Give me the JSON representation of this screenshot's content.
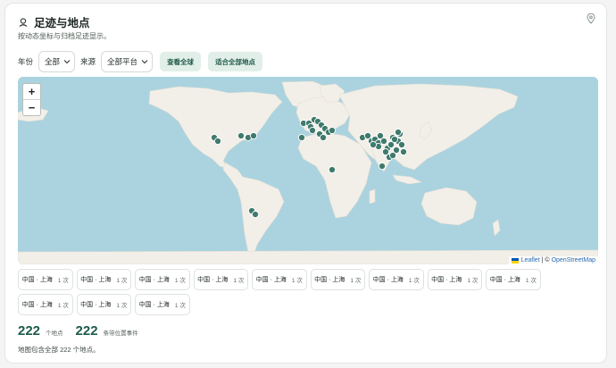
{
  "header": {
    "title": "足迹与地点",
    "subtitle": "按动态坐标与归档足迹显示。"
  },
  "filters": {
    "year_label": "年份",
    "year_value": "全部",
    "source_label": "来源",
    "source_value": "全部平台",
    "view_world_button": "查看全球",
    "fit_all_button": "适合全部地点"
  },
  "map": {
    "zoom_in": "+",
    "zoom_out": "−",
    "attribution_leaflet": "Leaflet",
    "attribution_sep": "| ©",
    "attribution_osm": "OpenStreetMap",
    "water_color": "#aad3df",
    "land_color": "#f2efe9",
    "marker_color": "#3f7a6c"
  },
  "places": [
    {
      "name": "中国 · 上海",
      "count": "1 次"
    },
    {
      "name": "中国 · 上海",
      "count": "1 次"
    },
    {
      "name": "中国 · 上海",
      "count": "1 次"
    },
    {
      "name": "中国 · 上海",
      "count": "1 次"
    },
    {
      "name": "中国 · 上海",
      "count": "1 次"
    },
    {
      "name": "中国 · 上海",
      "count": "1 次"
    },
    {
      "name": "中国 · 上海",
      "count": "1 次"
    },
    {
      "name": "中国 · 上海",
      "count": "1 次"
    },
    {
      "name": "中国 · 上海",
      "count": "1 次"
    },
    {
      "name": "中国 · 上海",
      "count": "1 次"
    },
    {
      "name": "中国 · 上海",
      "count": "1 次"
    },
    {
      "name": "中国 · 上海",
      "count": "1 次"
    }
  ],
  "stats": {
    "places_count": "222",
    "places_label": "个地点",
    "events_count": "222",
    "events_label": "条带位置事件"
  },
  "footer_note": "地图包含全部 222 个地点。"
}
